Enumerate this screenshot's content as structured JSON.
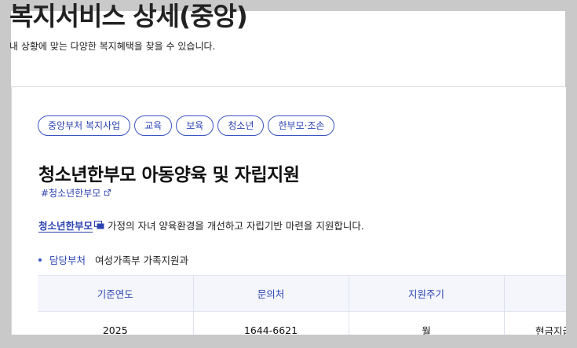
{
  "page": {
    "title": "복지서비스 상세(중앙)",
    "subtitle": "내 상황에 맞는 다양한 복지혜택을 찾을 수 있습니다."
  },
  "service": {
    "tags": [
      "중앙부처 복지사업",
      "교육",
      "보육",
      "청소년",
      "한부모·조손"
    ],
    "title": "청소년한부모 아동양육 및 자립지원",
    "hashtag": "#청소년한부모",
    "description_link": "청소년한부모",
    "description_text": " 가정의 자녀 양육환경을 개선하고 자립기반 마련을 지원합니다.",
    "department_label": "담당부처",
    "department_value": "여성가족부 가족지원과"
  },
  "table": {
    "headers": [
      "기준연도",
      "문의처",
      "지원주기",
      ""
    ],
    "rows": [
      [
        "2025",
        "1644-6621",
        "월",
        "현금지급"
      ]
    ]
  },
  "colors": {
    "accent": "#2d44b0",
    "tag_border": "#3b55c4",
    "header_bg": "#f4f6fb",
    "backdrop": "#c9c9c9"
  },
  "icons": {
    "hashtag_link": "external-link-icon",
    "description_link": "popup-window-icon",
    "department_bullet": "bullet-dot-icon"
  }
}
